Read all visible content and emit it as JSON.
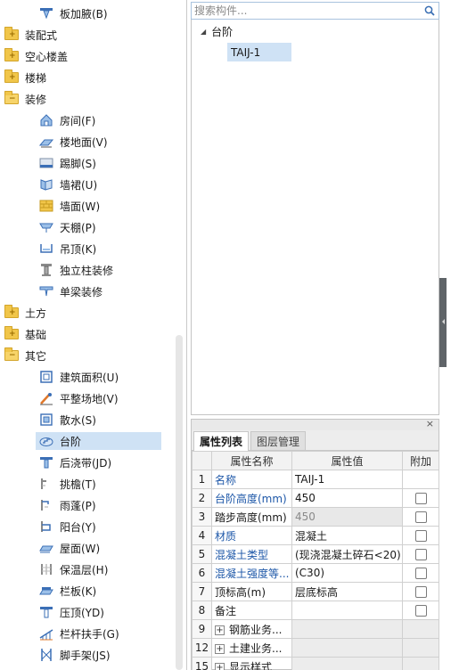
{
  "component_tree": {
    "rows": [
      {
        "type": "child",
        "icon": "board-haunch-icon",
        "label": "板加腋(B)"
      },
      {
        "type": "cat",
        "icon": "folder-icon",
        "label": "装配式"
      },
      {
        "type": "cat",
        "icon": "folder-icon",
        "label": "空心楼盖"
      },
      {
        "type": "cat",
        "icon": "folder-icon",
        "label": "楼梯"
      },
      {
        "type": "cat",
        "icon": "folder-open-icon",
        "label": "装修"
      },
      {
        "type": "child",
        "icon": "room-icon",
        "label": "房间(F)"
      },
      {
        "type": "child",
        "icon": "floor-surface-icon",
        "label": "楼地面(V)"
      },
      {
        "type": "child",
        "icon": "skirting-icon",
        "label": "踢脚(S)"
      },
      {
        "type": "child",
        "icon": "wall-skirt-icon",
        "label": "墙裙(U)"
      },
      {
        "type": "child",
        "icon": "wall-surface-icon",
        "label": "墙面(W)"
      },
      {
        "type": "child",
        "icon": "ceiling-icon",
        "label": "天棚(P)"
      },
      {
        "type": "child",
        "icon": "suspended-ceiling-icon",
        "label": "吊顶(K)"
      },
      {
        "type": "child",
        "icon": "column-decor-icon",
        "label": "独立柱装修"
      },
      {
        "type": "child",
        "icon": "beam-decor-icon",
        "label": "单梁装修"
      },
      {
        "type": "cat",
        "icon": "folder-icon",
        "label": "土方"
      },
      {
        "type": "cat",
        "icon": "folder-icon",
        "label": "基础"
      },
      {
        "type": "cat",
        "icon": "folder-open-icon",
        "label": "其它"
      },
      {
        "type": "child",
        "icon": "building-area-icon",
        "label": "建筑面积(U)"
      },
      {
        "type": "child",
        "icon": "site-leveling-icon",
        "label": "平整场地(V)"
      },
      {
        "type": "child",
        "icon": "apron-icon",
        "label": "散水(S)"
      },
      {
        "type": "child",
        "icon": "steps-icon",
        "label": "台阶",
        "selected": true
      },
      {
        "type": "child",
        "icon": "post-pour-strip-icon",
        "label": "后浇带(JD)"
      },
      {
        "type": "child",
        "icon": "cornice-icon",
        "label": "挑檐(T)"
      },
      {
        "type": "child",
        "icon": "canopy-icon",
        "label": "雨蓬(P)"
      },
      {
        "type": "child",
        "icon": "balcony-icon",
        "label": "阳台(Y)"
      },
      {
        "type": "child",
        "icon": "roof-icon",
        "label": "屋面(W)"
      },
      {
        "type": "child",
        "icon": "insulation-icon",
        "label": "保温层(H)"
      },
      {
        "type": "child",
        "icon": "parapet-icon",
        "label": "栏板(K)"
      },
      {
        "type": "child",
        "icon": "coping-icon",
        "label": "压顶(YD)"
      },
      {
        "type": "child",
        "icon": "railing-icon",
        "label": "栏杆扶手(G)"
      },
      {
        "type": "child",
        "icon": "scaffold-icon",
        "label": "脚手架(JS)"
      }
    ]
  },
  "search": {
    "placeholder": "搜索构件..."
  },
  "component_list": {
    "root_label": "台阶",
    "items": [
      "TAIJ-1"
    ]
  },
  "properties": {
    "close_glyph": "×",
    "tabs": [
      {
        "label": "属性列表",
        "active": true
      },
      {
        "label": "图层管理",
        "active": false
      }
    ],
    "headers": {
      "name": "属性名称",
      "value": "属性值",
      "extra": "附加"
    },
    "rows": [
      {
        "num": "1",
        "name": "名称",
        "value": "TAIJ-1",
        "blue": true,
        "checkbox": false
      },
      {
        "num": "2",
        "name": "台阶高度(mm)",
        "value": "450",
        "blue": true,
        "checkbox": true
      },
      {
        "num": "3",
        "name": "踏步高度(mm)",
        "value": "450",
        "blue": false,
        "checkbox": true,
        "disabled": true
      },
      {
        "num": "4",
        "name": "材质",
        "value": "混凝土",
        "blue": true,
        "checkbox": true
      },
      {
        "num": "5",
        "name": "混凝土类型",
        "value": "(现浇混凝土碎石<20)",
        "blue": true,
        "checkbox": true
      },
      {
        "num": "6",
        "name": "混凝土强度等...",
        "value": "(C30)",
        "blue": true,
        "checkbox": true
      },
      {
        "num": "7",
        "name": "顶标高(m)",
        "value": "层底标高",
        "blue": false,
        "checkbox": true
      },
      {
        "num": "8",
        "name": "备注",
        "value": "",
        "blue": false,
        "checkbox": true
      },
      {
        "num": "9",
        "name": "钢筋业务...",
        "value": "",
        "group": true
      },
      {
        "num": "12",
        "name": "土建业务...",
        "value": "",
        "group": true
      },
      {
        "num": "15",
        "name": "显示样式",
        "value": "",
        "group": true
      }
    ]
  }
}
